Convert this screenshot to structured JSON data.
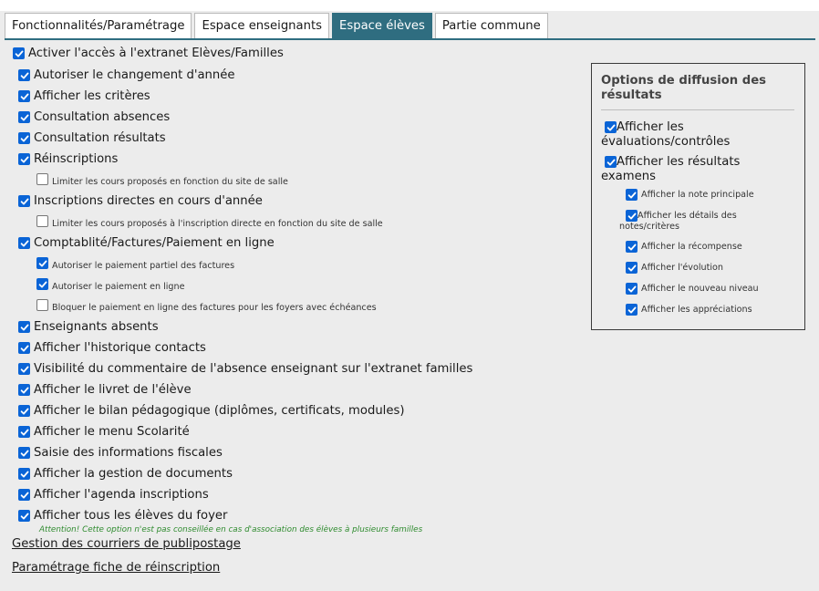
{
  "tabs": [
    {
      "label": "Fonctionnalités/Paramétrage",
      "active": false
    },
    {
      "label": "Espace enseignants",
      "active": false
    },
    {
      "label": "Espace élèves",
      "active": true
    },
    {
      "label": "Partie commune",
      "active": false
    }
  ],
  "options": [
    {
      "label": "Activer l'accès à l'extranet Elèves/Familles",
      "checked": true
    },
    {
      "label": "Autoriser le changement d'année",
      "checked": true
    },
    {
      "label": "Afficher les critères",
      "checked": true
    },
    {
      "label": "Consultation absences",
      "checked": true
    },
    {
      "label": "Consultation résultats",
      "checked": true
    },
    {
      "label": "Réinscriptions",
      "checked": true
    },
    {
      "label": "Limiter les cours proposés en fonction du site de salle",
      "checked": false
    },
    {
      "label": "Inscriptions directes en cours d'année",
      "checked": true
    },
    {
      "label": "Limiter les cours proposés à l'inscription directe en fonction du site de salle",
      "checked": false
    },
    {
      "label": "Comptablité/Factures/Paiement en ligne",
      "checked": true
    },
    {
      "label": "Autoriser le paiement partiel des factures",
      "checked": true
    },
    {
      "label": "Autoriser le paiement en ligne",
      "checked": true
    },
    {
      "label": "Bloquer le paiement en ligne des factures pour les foyers avec échéances",
      "checked": false
    },
    {
      "label": "Enseignants absents",
      "checked": true
    },
    {
      "label": "Afficher l'historique contacts",
      "checked": true
    },
    {
      "label": "Visibilité du commentaire de l'absence enseignant sur l'extranet familles",
      "checked": true
    },
    {
      "label": "Afficher le livret de l'élève",
      "checked": true
    },
    {
      "label": "Afficher le bilan pédagogique (diplômes, certificats, modules)",
      "checked": true
    },
    {
      "label": "Afficher le menu Scolarité",
      "checked": true
    },
    {
      "label": "Saisie des informations fiscales",
      "checked": true
    },
    {
      "label": "Afficher la gestion de documents",
      "checked": true
    },
    {
      "label": "Afficher l'agenda inscriptions",
      "checked": true
    },
    {
      "label": "Afficher tous les élèves du foyer",
      "checked": true
    }
  ],
  "warning": "Attention! Cette option n'est pas conseillée en cas d'association des élèves à plusieurs familles",
  "links": {
    "publipostage": "Gestion des courriers de publipostage",
    "reinscription": "Paramétrage fiche de réinscription"
  },
  "panel": {
    "title": "Options de diffusion des résultats",
    "options": [
      {
        "label": "Afficher les évaluations/contrôles",
        "checked": true
      },
      {
        "label": "Afficher les résultats examens",
        "checked": true
      },
      {
        "label": "Afficher la note principale",
        "checked": true
      },
      {
        "label": "Afficher les détails des notes/critères",
        "checked": true
      },
      {
        "label": "Afficher la récompense",
        "checked": true
      },
      {
        "label": "Afficher l'évolution",
        "checked": true
      },
      {
        "label": "Afficher le nouveau niveau",
        "checked": true
      },
      {
        "label": "Afficher les appréciations",
        "checked": true
      }
    ]
  },
  "colors": {
    "accent": "#2f6d80",
    "checkbox": "#0a64d6",
    "warning": "#2e8b2e"
  }
}
